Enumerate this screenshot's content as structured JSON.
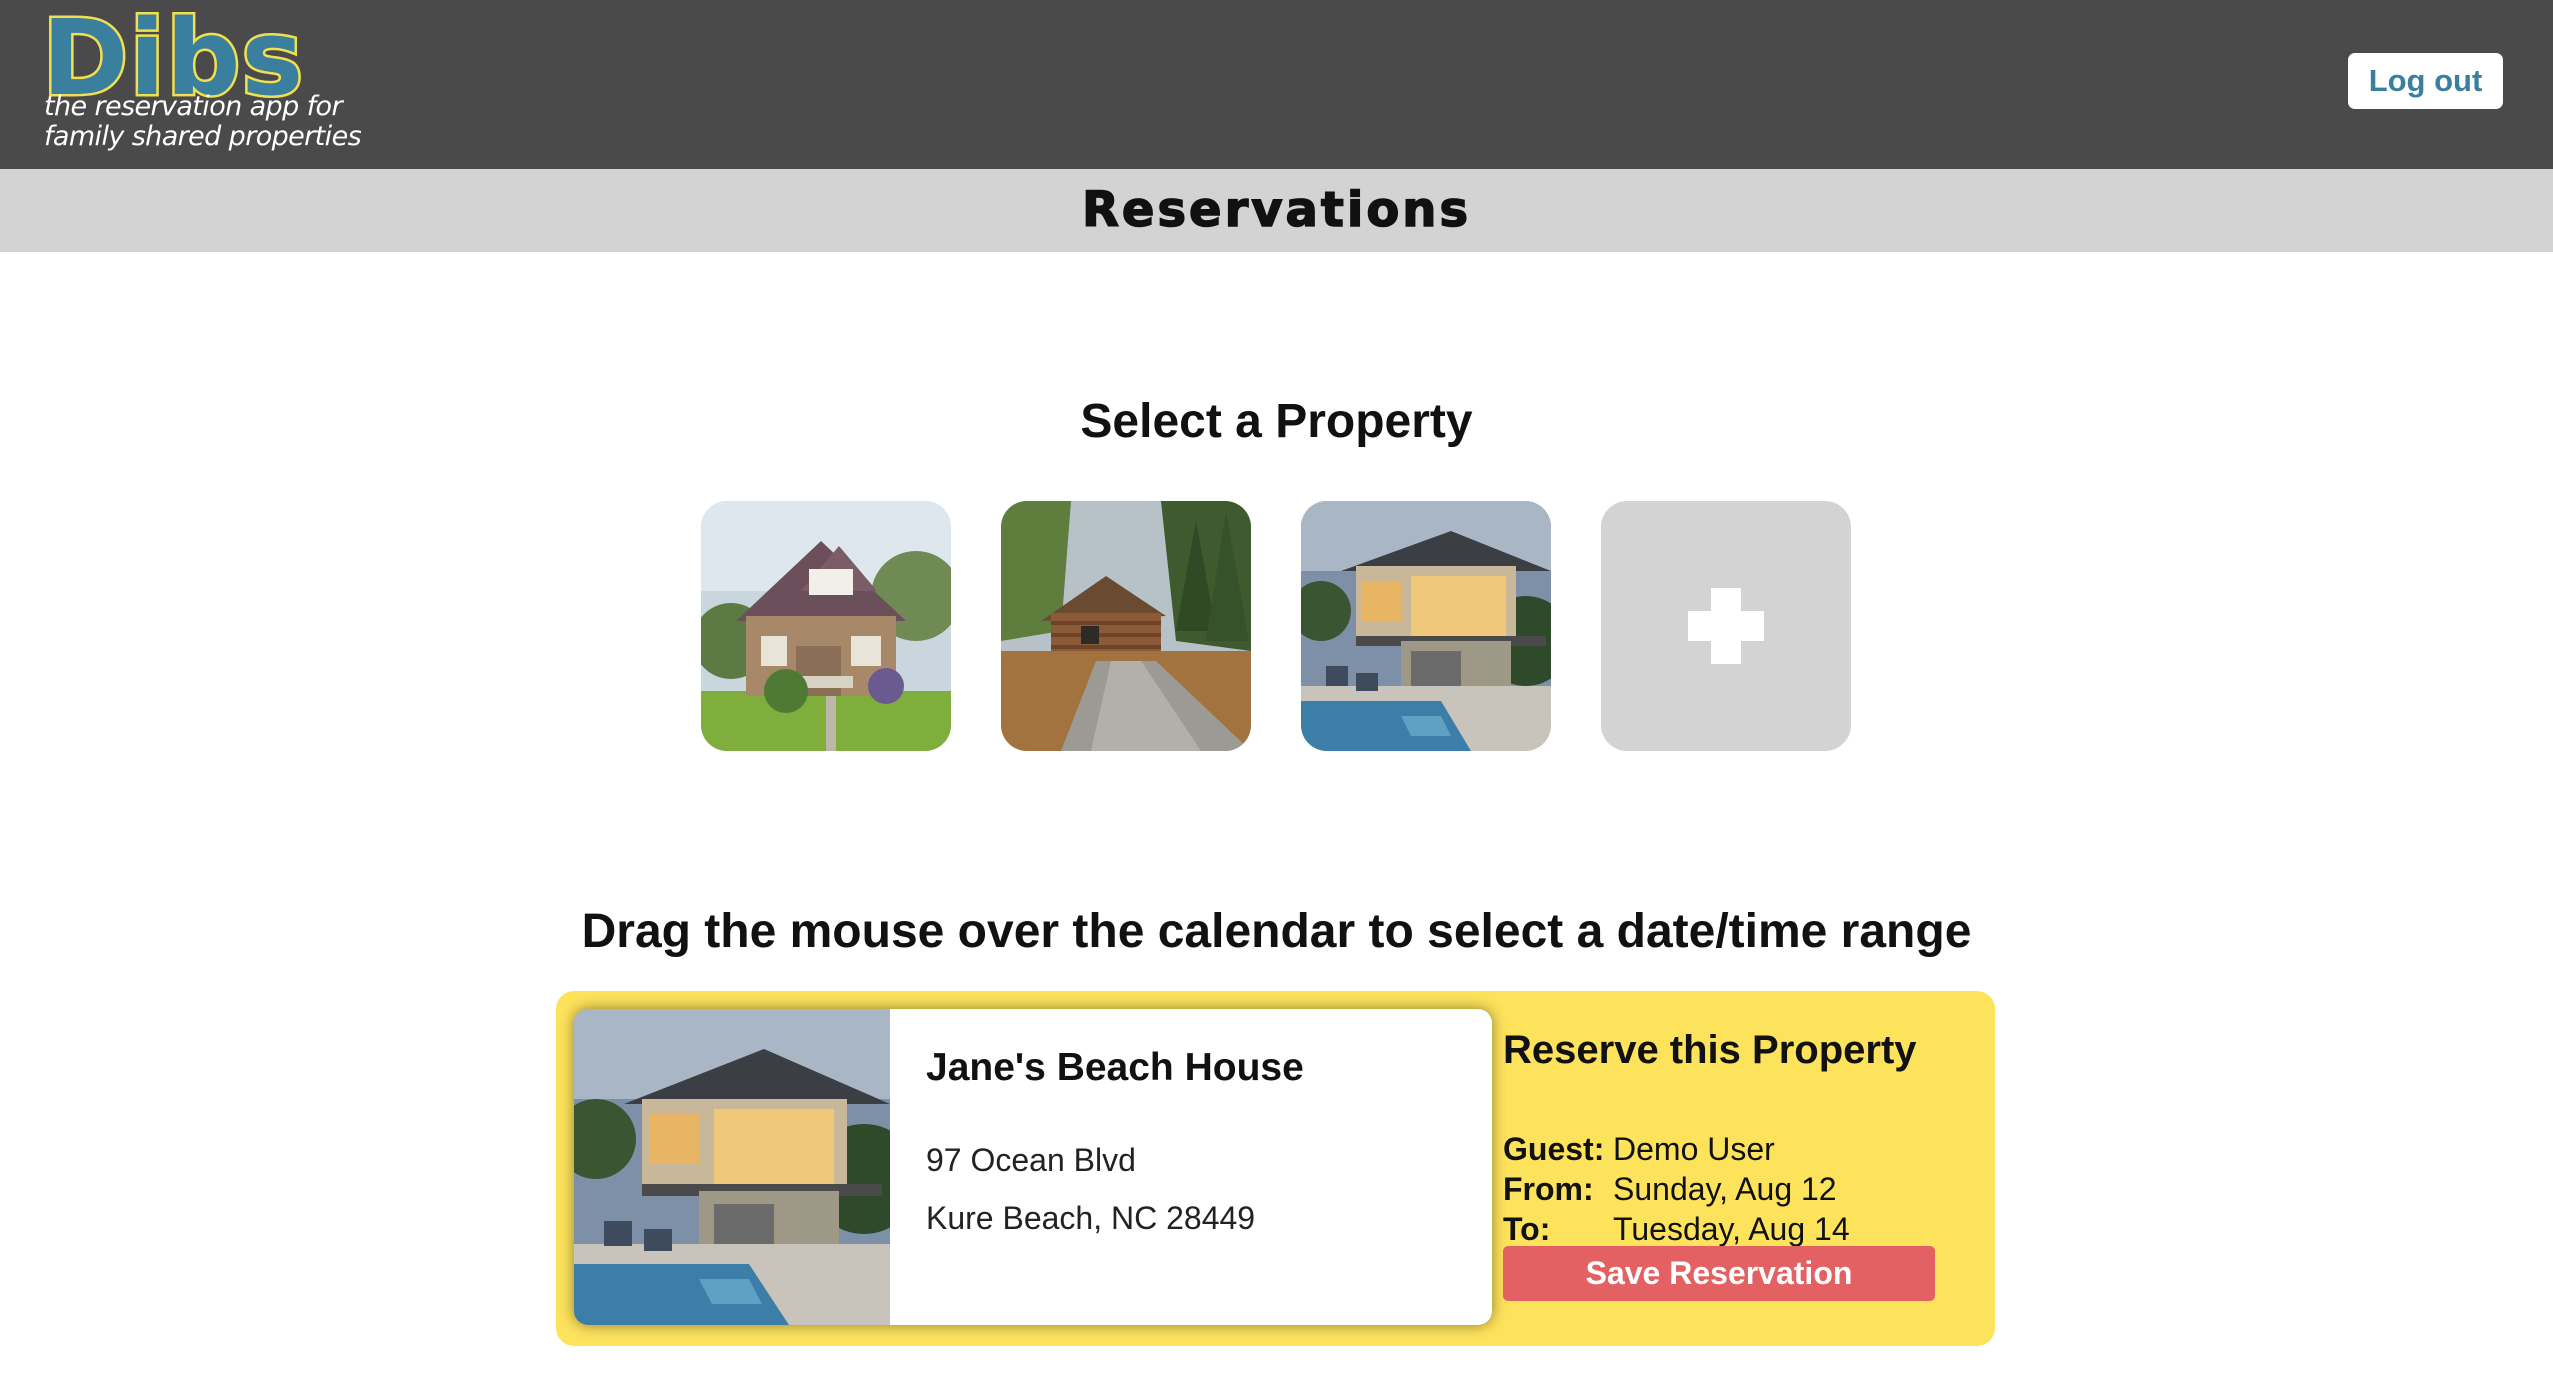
{
  "header": {
    "logo_text": "Dibs",
    "tagline_line1": "the reservation app for",
    "tagline_line2": "family shared properties",
    "logout_label": "Log out"
  },
  "subheader": {
    "title": "Reservations"
  },
  "select_property": {
    "title": "Select a Property",
    "properties": [
      {
        "icon": "craftsman-house-photo"
      },
      {
        "icon": "log-cabin-photo"
      },
      {
        "icon": "beach-house-photo"
      }
    ],
    "add_icon": "plus-icon"
  },
  "calendar": {
    "instruction": "Drag the mouse over the calendar to select a date/time range"
  },
  "selected_property": {
    "name": "Jane's Beach House",
    "address_line1": "97 Ocean Blvd",
    "address_line2": "Kure Beach, NC 28449"
  },
  "reservation": {
    "title": "Reserve this Property",
    "guest_label": "Guest:",
    "guest_value": "Demo User",
    "from_label": "From:",
    "from_value": "Sunday, Aug 12",
    "to_label": "To:",
    "to_value": "Tuesday, Aug 14",
    "save_label": "Save Reservation"
  },
  "colors": {
    "topbar": "#4a4a4a",
    "subheader": "#d3d3d3",
    "accent_blue": "#3a7f9e",
    "logo_outline": "#f1e04e",
    "panel_yellow": "#fde25b",
    "save_red": "#e36162"
  }
}
